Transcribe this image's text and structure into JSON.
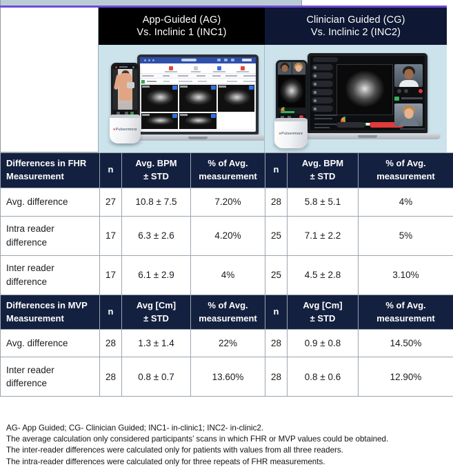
{
  "banner": {
    "left_col_blank": "",
    "ag": {
      "line1": "App-Guided (AG)",
      "line2": "Vs. Inclinic 1 (INC1)"
    },
    "cg": {
      "line1": "Clinician Guided (CG)",
      "line2": "Vs. Inclinic 2 (INC2)"
    }
  },
  "media": {
    "left_caption": "app-guided-scan-phone-laptop",
    "right_caption": "clinician-guided-telehealth-laptop",
    "probe_brand": "Pulsenmore"
  },
  "colors": {
    "navy": "#14203f",
    "black": "#000000",
    "panel_blue": "#cce3ec",
    "purple_rule": "#6f49d8",
    "grid": "#9aa5ae"
  },
  "fhr": {
    "header": {
      "label_line1": "Differences in FHR",
      "label_line2": "Measurement",
      "n1": "n",
      "avg1_line1": "Avg. BPM",
      "avg1_line2": "± STD",
      "pct1_line1": "% of Avg.",
      "pct1_line2": "measurement",
      "n2": "n",
      "avg2_line1": "Avg. BPM",
      "avg2_line2": "± STD",
      "pct2_line1": "% of Avg.",
      "pct2_line2": "measurement"
    },
    "rows": [
      {
        "label": "Avg. difference",
        "n1": "27",
        "avg1": "10.8 ± 7.5",
        "pct1": "7.20%",
        "n2": "28",
        "avg2": "5.8 ± 5.1",
        "pct2": "4%"
      },
      {
        "label": "Intra reader difference",
        "n1": "17",
        "avg1": "6.3 ± 2.6",
        "pct1": "4.20%",
        "n2": "25",
        "avg2": "7.1 ± 2.2",
        "pct2": "5%"
      },
      {
        "label": "Inter reader difference",
        "n1": "17",
        "avg1": "6.1 ± 2.9",
        "pct1": "4%",
        "n2": "25",
        "avg2": "4.5 ± 2.8",
        "pct2": "3.10%"
      }
    ]
  },
  "mvp": {
    "header": {
      "label_line1": "Differences in MVP",
      "label_line2": "Measurement",
      "n1": "n",
      "avg1_line1": "Avg [Cm]",
      "avg1_line2": "± STD",
      "pct1_line1": "% of Avg.",
      "pct1_line2": "measurement",
      "n2": "n",
      "avg2_line1": "Avg [Cm]",
      "avg2_line2": "± STD",
      "pct2_line1": "% of Avg.",
      "pct2_line2": "measurement"
    },
    "rows": [
      {
        "label": "Avg. difference",
        "n1": "28",
        "avg1": "1.3 ± 1.4",
        "pct1": "22%",
        "n2": "28",
        "avg2": "0.9 ± 0.8",
        "pct2": "14.50%"
      },
      {
        "label": "Inter reader difference",
        "n1": "28",
        "avg1": "0.8 ± 0.7",
        "pct1": "13.60%",
        "n2": "28",
        "avg2": "0.8 ± 0.6",
        "pct2": "12.90%"
      }
    ]
  },
  "footnote": {
    "line1": "AG- App Guided; CG- Clinician Guided; INC1- in-clinic1; INC2- in-clinic2.",
    "line2": "The average calculation only considered participants’ scans in which FHR or MVP values could be obtained.",
    "line3": "The inter-reader differences were calculated only for patients with values from all three readers.",
    "line4": "The intra-reader differences were calculated only for three repeats of FHR measurements."
  },
  "chart_data": {
    "type": "table",
    "title": "Differences in FHR and MVP Measurements: App-Guided vs Clinician-Guided",
    "groups": [
      "App-Guided (AG) Vs. Inclinic 1 (INC1)",
      "Clinician Guided (CG) Vs. Inclinic 2 (INC2)"
    ],
    "sections": [
      {
        "name": "Differences in FHR Measurement",
        "columns": [
          "Measurement",
          "n",
          "Avg. BPM ± STD",
          "% of Avg. measurement",
          "n",
          "Avg. BPM ± STD",
          "% of Avg. measurement"
        ],
        "rows": [
          [
            "Avg. difference",
            27,
            "10.8 ± 7.5",
            "7.20%",
            28,
            "5.8 ± 5.1",
            "4%"
          ],
          [
            "Intra reader difference",
            17,
            "6.3 ± 2.6",
            "4.20%",
            25,
            "7.1 ± 2.2",
            "5%"
          ],
          [
            "Inter reader difference",
            17,
            "6.1 ± 2.9",
            "4%",
            25,
            "4.5 ± 2.8",
            "3.10%"
          ]
        ]
      },
      {
        "name": "Differences in MVP Measurement",
        "columns": [
          "Measurement",
          "n",
          "Avg [Cm] ± STD",
          "% of Avg. measurement",
          "n",
          "Avg [Cm] ± STD",
          "% of Avg. measurement"
        ],
        "rows": [
          [
            "Avg. difference",
            28,
            "1.3 ± 1.4",
            "22%",
            28,
            "0.9 ± 0.8",
            "14.50%"
          ],
          [
            "Inter reader difference",
            28,
            "0.8 ± 0.7",
            "13.60%",
            28,
            "0.8 ± 0.6",
            "12.90%"
          ]
        ]
      }
    ]
  }
}
